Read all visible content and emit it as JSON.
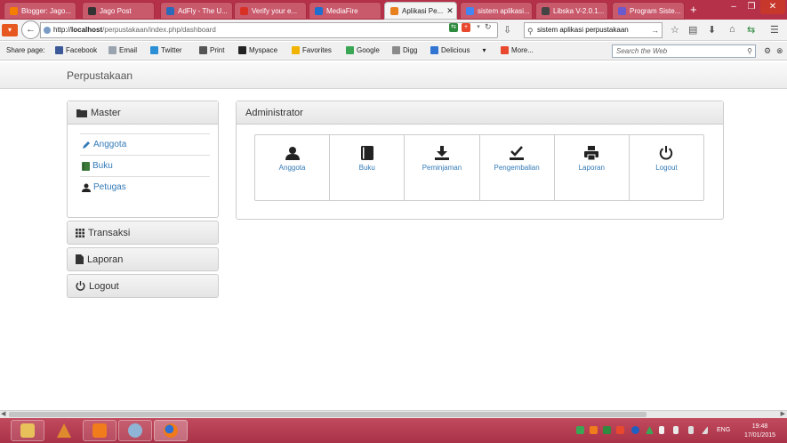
{
  "browser": {
    "tabs": [
      {
        "label": "Blogger: Jago...",
        "favicon_color": "#f57d00",
        "active": false
      },
      {
        "label": "Jago Post",
        "favicon_color": "#333333",
        "active": false
      },
      {
        "label": "AdFly - The U...",
        "favicon_color": "#2a6ab8",
        "active": false
      },
      {
        "label": "Verify your e...",
        "favicon_color": "#d93025",
        "active": false
      },
      {
        "label": "MediaFire",
        "favicon_color": "#1c6fcf",
        "active": false
      },
      {
        "label": "Aplikasi Pe...",
        "favicon_color": "#e8801e",
        "active": true
      },
      {
        "label": "sistem aplikasi...",
        "favicon_color": "#4285f4",
        "active": false
      },
      {
        "label": "Libska V-2.0.1...",
        "favicon_color": "#444444",
        "active": false
      },
      {
        "label": "Program Siste...",
        "favicon_color": "#6a5acd",
        "active": false
      }
    ],
    "new_tab": "+",
    "window_controls": {
      "minimize": "–",
      "maximize": "❐",
      "close": "✕"
    },
    "tab_close": "✕",
    "url": {
      "scheme": "http://",
      "host": "localhost",
      "path": "/perpustakaan/index.php/dashboard"
    },
    "search_value": "sistem aplikasi perpustakaan",
    "back_arrow": "←"
  },
  "share_toolbar": {
    "label": "Share page:",
    "items": [
      {
        "label": "Facebook",
        "icon": "facebook-icon",
        "color": "#3b5998"
      },
      {
        "label": "Email",
        "icon": "email-icon",
        "color": "#9aa4b0"
      },
      {
        "label": "Twitter",
        "icon": "twitter-icon",
        "color": "#2b8fd6"
      },
      {
        "label": "Print",
        "icon": "print-icon",
        "color": "#555555"
      },
      {
        "label": "Myspace",
        "icon": "myspace-icon",
        "color": "#222222"
      },
      {
        "label": "Favorites",
        "icon": "star-icon",
        "color": "#f0b400"
      },
      {
        "label": "Google",
        "icon": "google-icon",
        "color": "#3aa655"
      },
      {
        "label": "Digg",
        "icon": "digg-icon",
        "color": "#8a8a8a"
      },
      {
        "label": "Delicious",
        "icon": "delicious-icon",
        "color": "#3274d2"
      },
      {
        "label": "More...",
        "icon": "more-icon",
        "color": "#e8492e"
      }
    ],
    "web_search_placeholder": "Search the Web"
  },
  "app": {
    "brand": "Perpustakaan",
    "master": {
      "title": "Master",
      "items": [
        {
          "label": "Anggota",
          "icon": "pencil-icon"
        },
        {
          "label": "Buku",
          "icon": "book-icon"
        },
        {
          "label": "Petugas",
          "icon": "user-icon"
        }
      ]
    },
    "side_buttons": [
      {
        "label": "Transaksi",
        "icon": "grid-icon"
      },
      {
        "label": "Laporan",
        "icon": "file-icon"
      },
      {
        "label": "Logout",
        "icon": "power-icon"
      }
    ],
    "admin": {
      "title": "Administrator",
      "tiles": [
        {
          "label": "Anggota",
          "icon": "user-icon"
        },
        {
          "label": "Buku",
          "icon": "book-icon"
        },
        {
          "label": "Peminjaman",
          "icon": "download-icon"
        },
        {
          "label": "Pengembalian",
          "icon": "check-tray-icon"
        },
        {
          "label": "Laporan",
          "icon": "print-icon"
        },
        {
          "label": "Logout",
          "icon": "power-icon"
        }
      ]
    },
    "link_color": "#337ab7"
  },
  "taskbar": {
    "language": "ENG",
    "time": "19:48",
    "date": "17/01/2015"
  }
}
